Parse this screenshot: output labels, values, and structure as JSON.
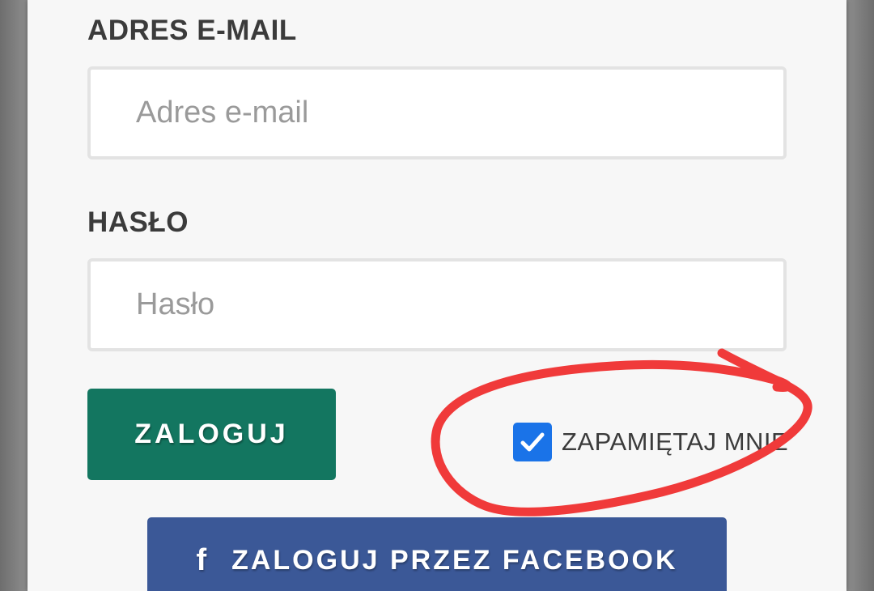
{
  "login_form": {
    "email_label": "ADRES E-MAIL",
    "email_placeholder": "Adres e-mail",
    "email_value": "",
    "password_label": "HASŁO",
    "password_placeholder": "Hasło",
    "password_value": "",
    "login_button": "ZALOGUJ",
    "remember_me_label": "ZAPAMIĘTAJ MNIE",
    "remember_me_checked": true,
    "facebook_button": "ZALOGUJ PRZEZ FACEBOOK",
    "facebook_icon": "f"
  },
  "colors": {
    "login_button": "#137660",
    "facebook_button": "#3b5897",
    "checkbox": "#1a73e8",
    "annotation": "#f03a3a"
  },
  "icons": {
    "checkbox": "check-icon",
    "facebook": "facebook-icon"
  }
}
